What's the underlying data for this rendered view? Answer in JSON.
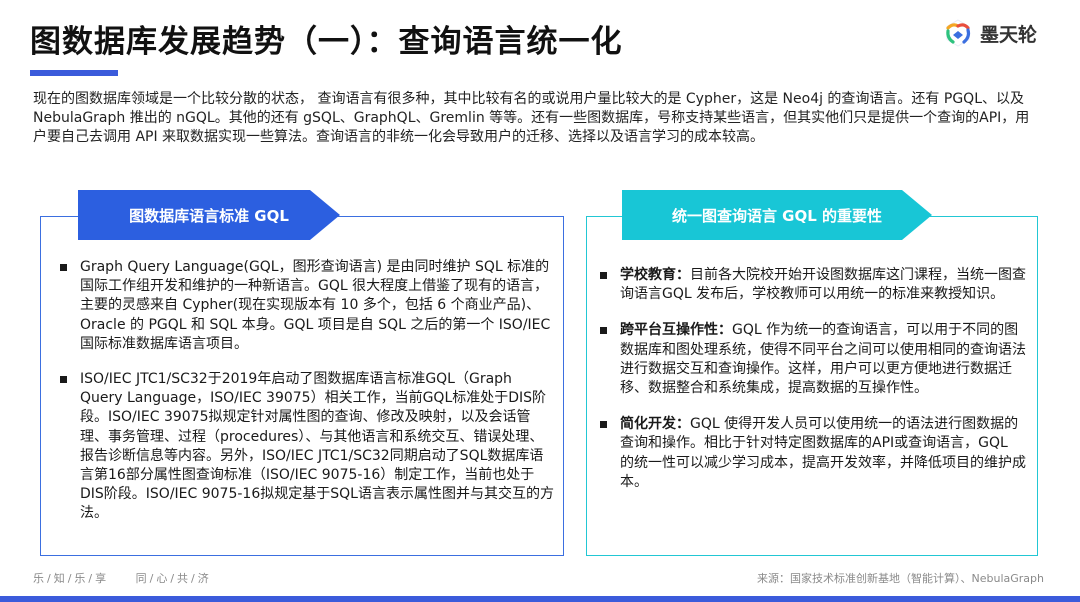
{
  "header": {
    "title": "图数据库发展趋势（一）：查询语言统一化",
    "logo_text": "墨天轮",
    "logo_icon": "motianlun-logo-icon"
  },
  "intro": "现在的图数据库领域是一个比较分散的状态， 查询语言有很多种，其中比较有名的或说用户量比较大的是 Cypher，这是 Neo4j 的查询语言。还有 PGQL、以及 NebulaGraph 推出的 nGQL。其他的还有 gSQL、GraphQL、Gremlin 等等。还有一些图数据库，号称支持某些语言，但其实他们只是提供一个查询的API，用户要自己去调用 API 来取数据实现一些算法。查询语言的非统一化会导致用户的迁移、选择以及语言学习的成本较高。",
  "left_panel": {
    "banner": "图数据库语言标准 GQL",
    "bullets": [
      "Graph Query Language(GQL，图形查询语言) 是由同时维护 SQL 标准的国际工作组开发和维护的一种新语言。GQL 很大程度上借鉴了现有的语言，主要的灵感来自 Cypher(现在实现版本有 10 多个，包括 6 个商业产品)、Oracle 的 PGQL 和 SQL 本身。GQL 项目是自 SQL 之后的第一个 ISO/IEC 国际标准数据库语言项目。",
      "ISO/IEC JTC1/SC32于2019年启动了图数据库语言标准GQL（Graph Query Language，ISO/IEC 39075）相关工作，当前GQL标准处于DIS阶段。ISO/IEC 39075拟规定针对属性图的查询、修改及映射，以及会话管理、事务管理、过程（procedures）、与其他语言和系统交互、错误处理、报告诊断信息等内容。另外，ISO/IEC JTC1/SC32同期启动了SQL数据库语言第16部分属性图查询标准（ISO/IEC 9075-16）制定工作，当前也处于DIS阶段。ISO/IEC 9075-16拟规定基于SQL语言表示属性图并与其交互的方法。"
    ]
  },
  "right_panel": {
    "banner": "统一图查询语言 GQL 的重要性",
    "bullets": [
      {
        "term": "学校教育：",
        "text": "目前各大院校开始开设图数据库这门课程，当统一图查询语言GQL 发布后，学校教师可以用统一的标准来教授知识。"
      },
      {
        "term": "跨平台互操作性：",
        "text": "GQL 作为统一的查询语言，可以用于不同的图数据库和图处理系统，使得不同平台之间可以使用相同的查询语法进行数据交互和查询操作。这样，用户可以更方便地进行数据迁移、数据整合和系统集成，提高数据的互操作性。"
      },
      {
        "term": "简化开发：",
        "text": "GQL 使得开发人员可以使用统一的语法进行图数据的查询和操作。相比于针对特定图数据库的API或查询语言，GQL 的统一性可以减少学习成本，提高开发效率，并降低项目的维护成本。"
      }
    ]
  },
  "footer": {
    "slogan_1": "乐/知/乐/享",
    "slogan_2": "同/心/共/济",
    "source": "来源：国家技术标准创新基地（智能计算）、NebulaGraph"
  },
  "colors": {
    "accent_blue": "#2c5fe0",
    "accent_cyan": "#18c6d6",
    "underline": "#3b5bdb"
  }
}
